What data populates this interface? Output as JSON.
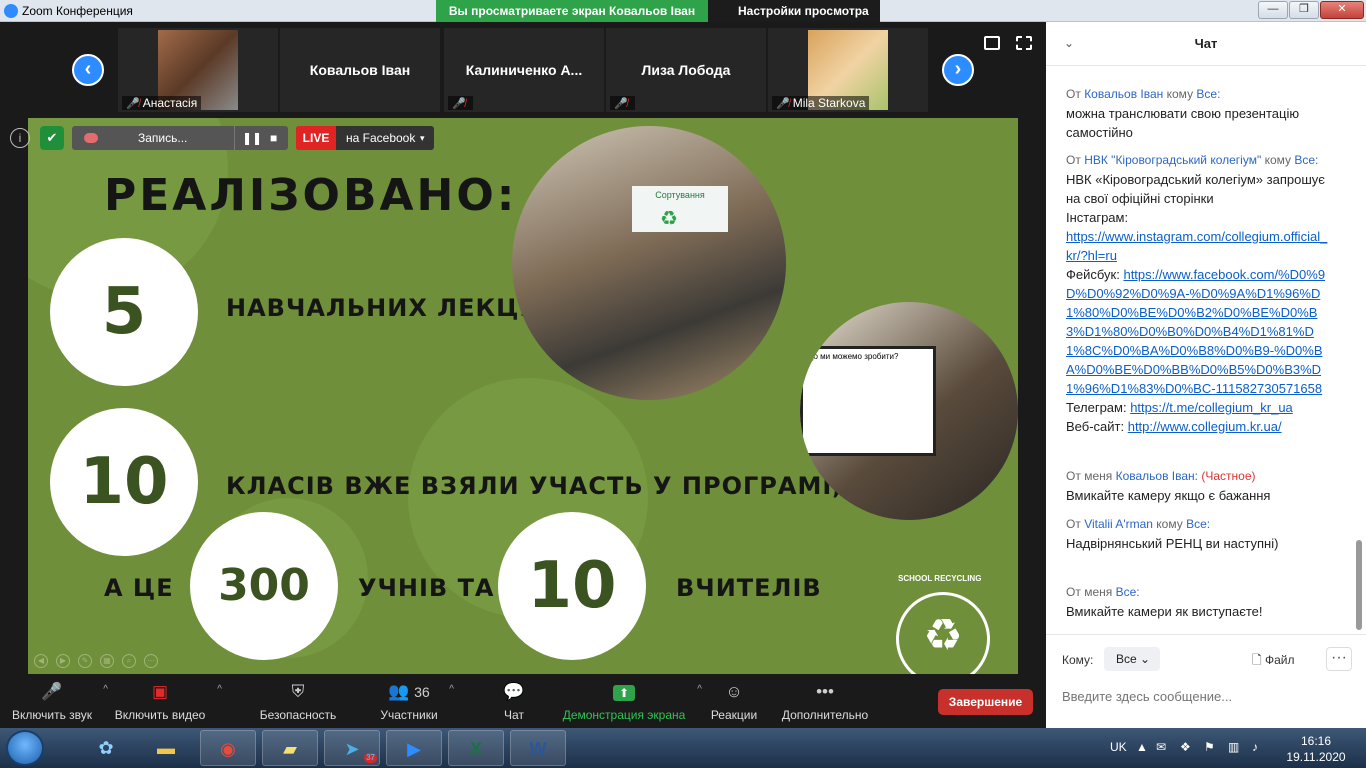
{
  "window": {
    "title": "Zoom Конференция",
    "share_banner": "Вы просматриваете экран Ковальов Іван",
    "view_options": "Настройки просмотра"
  },
  "participants": [
    {
      "name": "Анастасія",
      "muted": true,
      "has_photo": true
    },
    {
      "name": "Ковальов Іван",
      "muted": false,
      "has_photo": false
    },
    {
      "name": "Калиниченко  А...",
      "muted": true,
      "has_photo": false
    },
    {
      "name": "Лиза Лобода",
      "muted": true,
      "has_photo": false
    },
    {
      "name": "Mila Starkova",
      "muted": true,
      "has_photo": true
    }
  ],
  "recording": {
    "label": "Запись...",
    "live_badge": "LIVE",
    "live_target": "на Facebook"
  },
  "slide": {
    "title": "РЕАЛІЗОВАНО:",
    "items": [
      {
        "value": "5",
        "caption": "НАВЧАЛЬНИХ ЛЕКЦІЙ"
      },
      {
        "value": "10",
        "caption": "КЛАСІВ ВЖЕ ВЗЯЛИ УЧАСТЬ У ПРОГРАМІ,"
      }
    ],
    "prefix": "А ЦЕ",
    "students": "300",
    "students_caption": "УЧНІВ ТА",
    "teachers": "10",
    "teachers_caption": "ВЧИТЕЛІВ",
    "logo_text": "SCHOOL RECYCLING",
    "photo1_sign": "Сортування",
    "photo2_sign": "Що ми можемо зробити?"
  },
  "toolbar": {
    "audio": "Включить звук",
    "video": "Включить видео",
    "security": "Безопасность",
    "participants": "Участники",
    "participants_count": "36",
    "chat": "Чат",
    "share": "Демонстрация экрана",
    "reactions": "Реакции",
    "more": "Дополнительно",
    "end": "Завершение"
  },
  "chat": {
    "header": "Чат",
    "messages": [
      {
        "from_prefix": "От",
        "sender": "Ковальов Іван",
        "to_prefix": "кому",
        "to": "Все:",
        "text": "можна транслювати свою презентацію самостійно"
      },
      {
        "from_prefix": "От",
        "sender": "НВК \"Кіровоградський колегіум\"",
        "to_prefix": "кому",
        "to": "Все:",
        "line1": "НВК «Кіровоградський колегіум» запрошує на свої офіційні сторінки",
        "line2": "Інстаграм:",
        "link_instagram": "https://www.instagram.com/collegium.official_kr/?hl=ru",
        "fb_label": "Фейсбук:",
        "link_facebook": "https://www.facebook.com/%D0%9D%D0%92%D0%9A-%D0%9A%D1%96%D1%80%D0%BE%D0%B2%D0%BE%D0%B3%D1%80%D0%B0%D0%B4%D1%81%D1%8C%D0%BA%D0%B8%D0%B9-%D0%BA%D0%BE%D0%BB%D0%B5%D0%B3%D1%96%D1%83%D0%BC-111582730571658",
        "tg_label": "Телеграм:",
        "link_telegram": "https://t.me/collegium_kr_ua",
        "web_label": "Веб-сайт:",
        "link_web": "http://www.collegium.kr.ua/"
      },
      {
        "from_prefix": "От",
        "sender": "меня",
        "to": "Ковальов Іван:",
        "private": "(Частное)",
        "text": "Вмикайте камеру якщо є бажання"
      },
      {
        "from_prefix": "От",
        "sender": "Vitalii A'rman",
        "to_prefix": "кому",
        "to": "Все:",
        "text": "Надвірнянський РЕНЦ ви наступні)"
      },
      {
        "from_prefix": "От",
        "sender": "меня",
        "to": "Все:",
        "text": "Вмикайте камери як виступаєте!"
      }
    ],
    "to_label": "Кому:",
    "to_value": "Все",
    "file_label": "Файл",
    "more": "···",
    "input_placeholder": "Введите здесь сообщение..."
  },
  "taskbar": {
    "lang": "UK",
    "time": "16:16",
    "date": "19.11.2020",
    "telegram_badge": "37"
  },
  "colors": {
    "slide_green": "#6f8f3a",
    "zoom_blue": "#2d8cff",
    "share_green": "#2fa34a",
    "end_red": "#c8312b"
  }
}
